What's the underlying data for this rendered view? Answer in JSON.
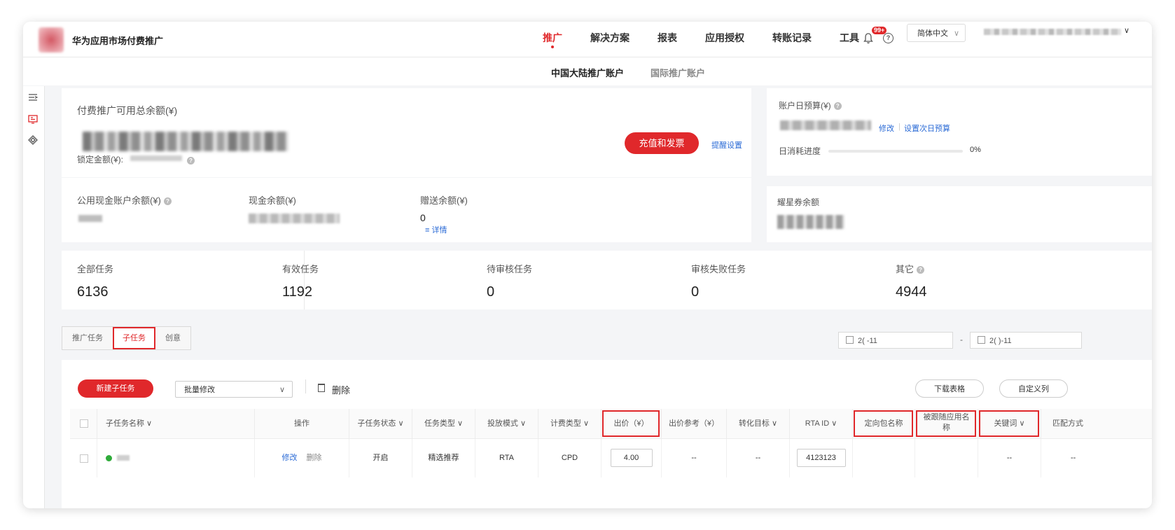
{
  "header": {
    "brand": "华为应用市场付费推广",
    "nav": [
      "推广",
      "解决方案",
      "报表",
      "应用授权",
      "转账记录",
      "工具"
    ],
    "badge": "99+",
    "help": "?",
    "language": "简体中文",
    "chevron": "∨"
  },
  "subnav": {
    "tabs": [
      "中国大陆推广账户",
      "国际推广账户"
    ]
  },
  "sidebar": {
    "icons": [
      "menu-icon",
      "ad-monitor-icon",
      "diamond-icon"
    ]
  },
  "balance": {
    "title": "付费推广可用总余额(¥)",
    "locked_label": "锁定金额(¥):",
    "recharge_button": "充值和发票",
    "reminder_link": "提醒设置",
    "public_cash_label": "公用现金账户余额(¥)",
    "cash_label": "现金余额(¥)",
    "gift_label": "赠送余额(¥)",
    "gift_value": "0",
    "detail_link": "≡ 详情"
  },
  "budget": {
    "title": "账户日预算(¥)",
    "modify_link": "修改",
    "separator": "|",
    "next_day_link": "设置次日预算",
    "progress_label": "日消耗进度",
    "progress_value": "0%",
    "progress_fraction": 0
  },
  "coupon": {
    "title": "耀星券余额"
  },
  "stats": [
    {
      "label": "全部任务",
      "value": "6136"
    },
    {
      "label": "有效任务",
      "value": "1192"
    },
    {
      "label": "待审核任务",
      "value": "0"
    },
    {
      "label": "审核失败任务",
      "value": "0"
    },
    {
      "label": "其它",
      "value": "4944"
    }
  ],
  "tabs": [
    "推广任务",
    "子任务",
    "创意"
  ],
  "date_range": {
    "start": "2(      -11",
    "separator": "-",
    "end": "2(      )-11"
  },
  "toolbar": {
    "new_button": "新建子任务",
    "batch_select": "批量修改",
    "delete_label": "删除",
    "download_button": "下载表格",
    "custom_columns_button": "自定义列"
  },
  "table": {
    "columns": [
      "子任务名称 ∨",
      "操作",
      "子任务状态 ∨",
      "任务类型 ∨",
      "投放模式 ∨",
      "计费类型 ∨",
      "出价（¥）",
      "出价参考（¥）",
      "转化目标 ∨",
      "RTA ID ∨",
      "定向包名称",
      "被跟随应用名称",
      "关键词 ∨",
      "匹配方式"
    ],
    "row": {
      "actions": [
        "修改",
        "删除"
      ],
      "status": "开启",
      "task_type": "精选推荐",
      "delivery_mode": "RTA",
      "billing_type": "CPD",
      "bid": "4.00",
      "bid_reference": "--",
      "conversion_target": "--",
      "rta_id": "4123123",
      "keywords": "--",
      "match": "--"
    }
  },
  "colors": {
    "accent": "#e0282b",
    "link": "#2b6bd6"
  }
}
